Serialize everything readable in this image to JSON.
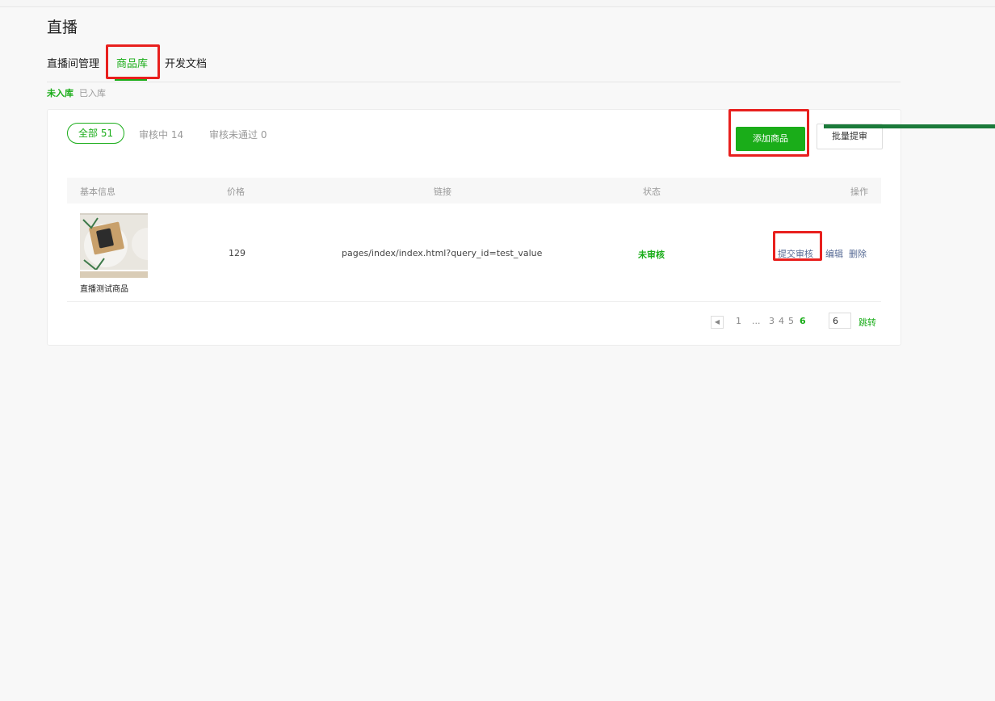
{
  "page": {
    "title": "直播"
  },
  "tabs": [
    {
      "label": "直播间管理"
    },
    {
      "label": "商品库"
    },
    {
      "label": "开发文档"
    }
  ],
  "subtabs": [
    {
      "label": "未入库"
    },
    {
      "label": "已入库"
    }
  ],
  "filters": {
    "all": "全部 51",
    "reviewing": "审核中 14",
    "rejected": "审核未通过 0"
  },
  "buttons": {
    "add": "添加商品",
    "batch": "批量提审"
  },
  "table": {
    "headers": [
      "基本信息",
      "价格",
      "链接",
      "状态",
      "操作"
    ],
    "rows": [
      {
        "name": "直播测试商品",
        "price": "129",
        "link": "pages/index/index.html?query_id=test_value",
        "status": "未审核",
        "actions": [
          "提交审核",
          "编辑",
          "删除"
        ]
      }
    ]
  },
  "pagination": {
    "prev_icon": "chevron-left-icon",
    "pages": [
      "1",
      "...",
      "3",
      "4",
      "5",
      "6"
    ],
    "current": "6",
    "input_value": "6",
    "jump_label": "跳转"
  },
  "colors": {
    "accent": "#1aad19",
    "link": "#576b95",
    "highlight": "#e8201e",
    "arrow": "#1b7a3a"
  }
}
